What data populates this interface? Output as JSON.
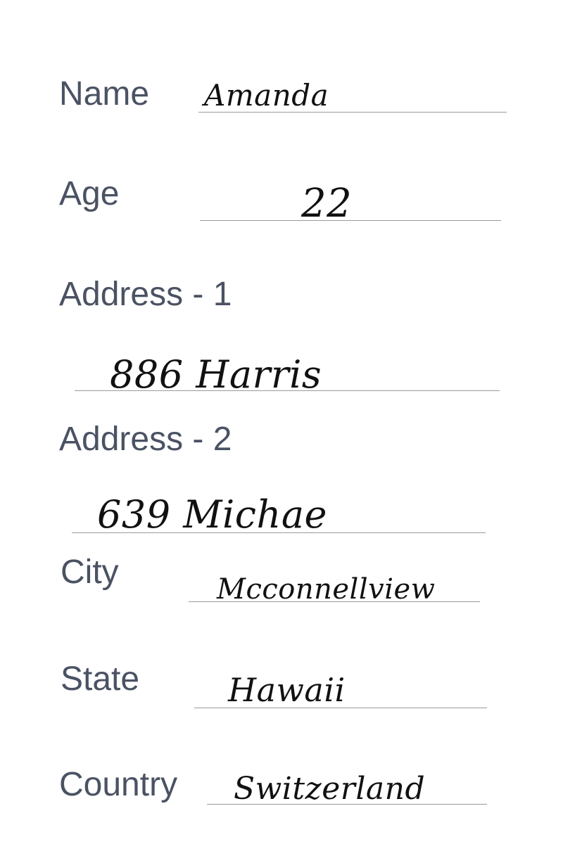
{
  "form": {
    "name": {
      "label": "Name",
      "value": "Amanda"
    },
    "age": {
      "label": "Age",
      "value": "22"
    },
    "address1": {
      "label": "Address - 1",
      "value": "886 Harris"
    },
    "address2": {
      "label": "Address - 2",
      "value": "639 Michae"
    },
    "city": {
      "label": "City",
      "value": "Mcconnellview"
    },
    "state": {
      "label": "State",
      "value": "Hawaii"
    },
    "country": {
      "label": "Country",
      "value": "Switzerland"
    }
  }
}
